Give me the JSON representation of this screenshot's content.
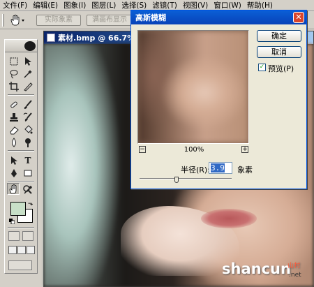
{
  "menu": {
    "items": [
      "文件(F)",
      "编辑(E)",
      "图象(I)",
      "图层(L)",
      "选择(S)",
      "滤镜(T)",
      "视图(V)",
      "窗口(W)",
      "帮助(H)"
    ]
  },
  "options_bar": {
    "tool_icon": "hand-icon",
    "actual_pixels_label": "实际象素",
    "fit_screen_label": "满画布显示"
  },
  "toolbox": {
    "tools": [
      "marquee-icon",
      "move-icon",
      "lasso-icon",
      "magic-wand-icon",
      "crop-icon",
      "slice-icon",
      "healing-brush-icon",
      "brush-icon",
      "clone-stamp-icon",
      "history-brush-icon",
      "eraser-icon",
      "paint-bucket-icon",
      "blur-icon",
      "dodge-icon",
      "path-select-icon",
      "type-icon",
      "pen-icon",
      "shape-icon",
      "notes-icon",
      "eyedropper-icon",
      "hand-icon",
      "zoom-icon"
    ],
    "foreground_color": "#c8e0c8",
    "background_color": "#ffffff"
  },
  "document": {
    "title": "素材.bmp @ 66.7%(RGB)"
  },
  "watermark": {
    "brand": "shancun",
    "sub": "山村",
    "domain": ".net"
  },
  "dialog": {
    "title": "高斯模糊",
    "ok_label": "确定",
    "cancel_label": "取消",
    "preview_label": "预览(P)",
    "preview_checked": true,
    "zoom_level": "100%",
    "radius_label": "半径(R):",
    "radius_value": "3.9",
    "unit_label": "象素",
    "radius_slider_fraction": 0.4
  },
  "colors": {
    "dialog_title": "#0a5fd6",
    "doc_title": "#0a246a"
  }
}
